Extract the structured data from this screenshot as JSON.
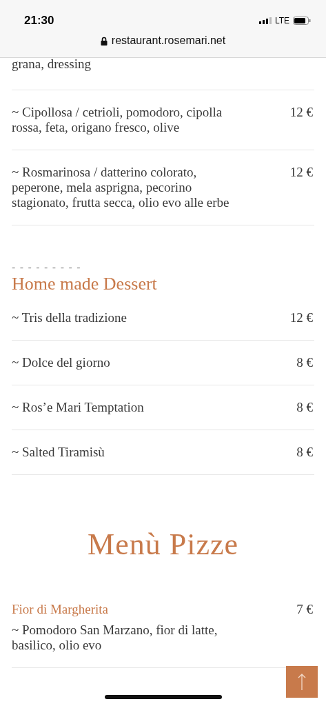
{
  "status_bar": {
    "time": "21:30",
    "network": "LTE"
  },
  "address_bar": {
    "url": "restaurant.rosemari.net"
  },
  "top_fragment": "grana, dressing",
  "salads": [
    {
      "description": "~ Cipollosa / cetrioli, pomodoro, cipolla rossa, feta, origano fresco, olive",
      "price": "12 €"
    },
    {
      "description": "~ Rosmarinosa / datterino colorato, peperone, mela asprigna, pecorino stagionato, frutta secca, olio evo alle erbe",
      "price": "12 €"
    }
  ],
  "dessert": {
    "divider": "- - - - - - - - -",
    "title": "Home made Dessert",
    "items": [
      {
        "description": "~ Tris della tradizione",
        "price": "12 €"
      },
      {
        "description": "~ Dolce del giorno",
        "price": "8 €"
      },
      {
        "description": "~ Ros’e Mari Temptation",
        "price": "8 €"
      },
      {
        "description": "~ Salted Tiramisù",
        "price": "8 €"
      }
    ]
  },
  "pizza_menu": {
    "title": "Menù Pizze",
    "items": [
      {
        "name": "Fior di Margherita",
        "description": "~ Pomodoro San Marzano, fior di latte, basilico, olio evo",
        "price": "7 €"
      }
    ]
  }
}
